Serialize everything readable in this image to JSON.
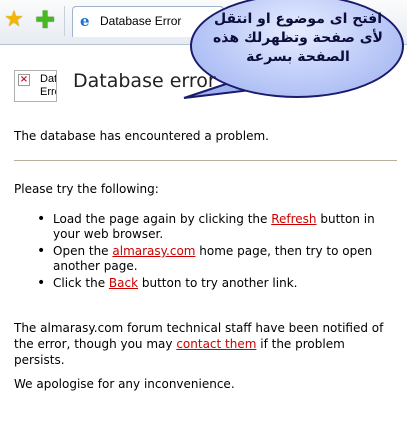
{
  "browser": {
    "tab_title": "Database Error",
    "icons": {
      "favorites": "star-icon",
      "add_favorite": "add-favorite-icon",
      "page": "ie-page-icon"
    }
  },
  "callout": {
    "lines": [
      "افتح اى موضوع او انتقل",
      "لأى صفحة وتظهرلك هذه",
      "الصفحة بسرعة"
    ]
  },
  "error": {
    "img_alt": "Database Error",
    "title": "Database error",
    "message": "The database has encountered a problem."
  },
  "try": {
    "heading": "Please try the following:",
    "item1": {
      "before": "Load the page again by clicking the ",
      "link": "Refresh",
      "after": " button in your web browser."
    },
    "item2": {
      "before": "Open the ",
      "link": "almarasy.com",
      "after": " home page, then try to open another page."
    },
    "item3": {
      "before": "Click the ",
      "link": "Back",
      "after": " button to try another link."
    }
  },
  "notice": {
    "before": "The almarasy.com forum technical staff have been notified of the error, though you may ",
    "link": "contact them",
    "after": " if the problem persists."
  },
  "apology": "We apologise for any inconvenience.",
  "colors": {
    "link": "#cc0000",
    "rule": "#b9b19b",
    "bubble_border": "#1a1a6e"
  }
}
